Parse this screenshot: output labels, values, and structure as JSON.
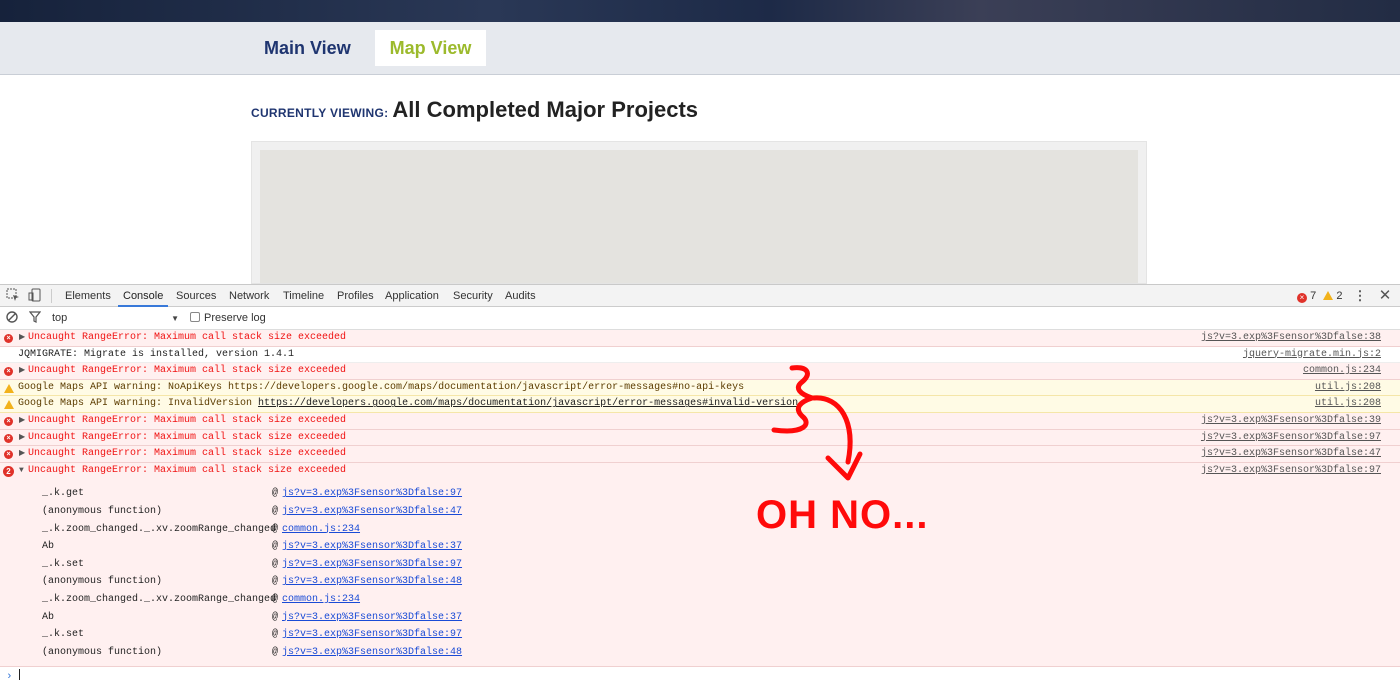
{
  "site": {
    "tabs": [
      {
        "label": "Main View"
      },
      {
        "label": "Map View"
      }
    ],
    "viewing_label": "CURRENTLY VIEWING:",
    "viewing_title": "All Completed Major Projects"
  },
  "devtools": {
    "tabs": [
      "Elements",
      "Console",
      "Sources",
      "Network",
      "Timeline",
      "Profiles",
      "Application",
      "Security",
      "Audits"
    ],
    "active_tab": "Console",
    "error_count": "7",
    "warning_count": "2",
    "context": "top",
    "preserve_log_label": "Preserve log",
    "messages": [
      {
        "level": "error",
        "text": "Uncaught RangeError: Maximum call stack size exceeded",
        "source": "js?v=3.exp%3Fsensor%3Dfalse:38"
      },
      {
        "level": "info",
        "text": "JQMIGRATE: Migrate is installed, version 1.4.1",
        "source": "jquery-migrate.min.js:2"
      },
      {
        "level": "error",
        "text": "Uncaught RangeError: Maximum call stack size exceeded",
        "source": "common.js:234"
      },
      {
        "level": "warn",
        "text": "Google Maps API warning: NoApiKeys https://developers.google.com/maps/documentation/javascript/error-messages#no-api-keys",
        "source": "util.js:208"
      },
      {
        "level": "warn",
        "text_prefix": "Google Maps API warning: InvalidVersion ",
        "link": "https://developers.google.com/maps/documentation/javascript/error-messages#invalid-version",
        "source": "util.js:208"
      },
      {
        "level": "error",
        "text": "Uncaught RangeError: Maximum call stack size exceeded",
        "source": "js?v=3.exp%3Fsensor%3Dfalse:39"
      },
      {
        "level": "error",
        "text": "Uncaught RangeError: Maximum call stack size exceeded",
        "source": "js?v=3.exp%3Fsensor%3Dfalse:97"
      },
      {
        "level": "error",
        "text": "Uncaught RangeError: Maximum call stack size exceeded",
        "source": "js?v=3.exp%3Fsensor%3Dfalse:47"
      },
      {
        "level": "error",
        "count": "2",
        "text": "Uncaught RangeError: Maximum call stack size exceeded",
        "source": "js?v=3.exp%3Fsensor%3Dfalse:97"
      }
    ],
    "stack": [
      {
        "fn": "_.k.get",
        "loc": "js?v=3.exp%3Fsensor%3Dfalse:97"
      },
      {
        "fn": "(anonymous function)",
        "loc": "js?v=3.exp%3Fsensor%3Dfalse:47"
      },
      {
        "fn": "_.k.zoom_changed._.xv.zoomRange_changed",
        "loc": "common.js:234"
      },
      {
        "fn": "Ab",
        "loc": "js?v=3.exp%3Fsensor%3Dfalse:37"
      },
      {
        "fn": "_.k.set",
        "loc": "js?v=3.exp%3Fsensor%3Dfalse:97"
      },
      {
        "fn": "(anonymous function)",
        "loc": "js?v=3.exp%3Fsensor%3Dfalse:48"
      },
      {
        "fn": "_.k.zoom_changed._.xv.zoomRange_changed",
        "loc": "common.js:234"
      },
      {
        "fn": "Ab",
        "loc": "js?v=3.exp%3Fsensor%3Dfalse:37"
      },
      {
        "fn": "_.k.set",
        "loc": "js?v=3.exp%3Fsensor%3Dfalse:97"
      },
      {
        "fn": "(anonymous function)",
        "loc": "js?v=3.exp%3Fsensor%3Dfalse:48"
      }
    ],
    "at_symbol": "@"
  },
  "annotation": {
    "text": "OH NO...",
    "color": "#ff0a0a"
  },
  "colors": {
    "nav_blue": "#1f3570",
    "map_green": "#9cba2c",
    "error_red": "#f01313",
    "error_bg": "#fff0f0",
    "warn_bg": "#fffbe5",
    "active_tab_blue": "#3879d9"
  }
}
